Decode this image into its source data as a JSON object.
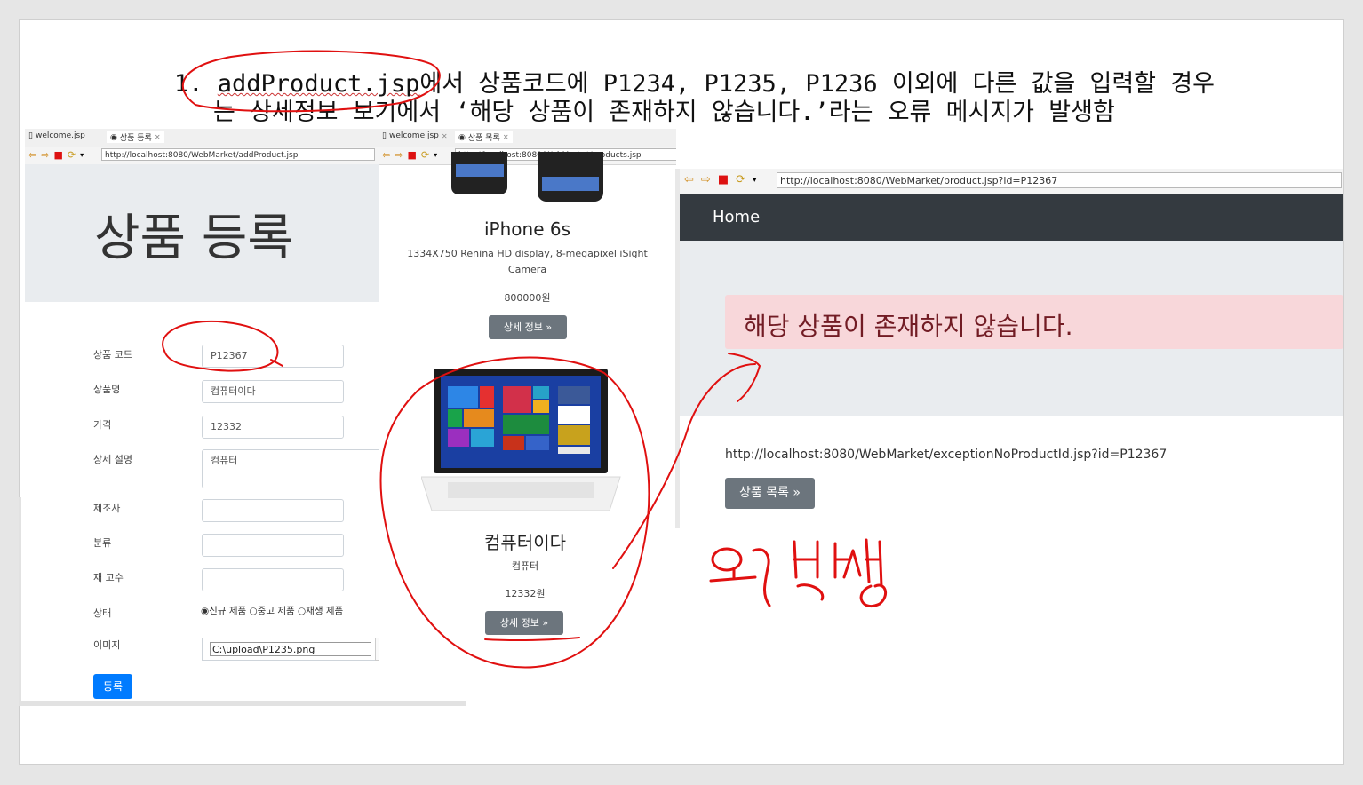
{
  "caption": {
    "line1_prefix": "1. ",
    "line1_file": "addProduct.jsp",
    "line1_rest": "에서 상품코드에 P1234, P1235, P1236 이외에 다른 값을 입력할 경우",
    "line2": "는 상세정보 보기에서 ‘해당 상품이 존재하지 않습니다.’라는 오류 메시지가 발생함"
  },
  "left_browser": {
    "tabs": [
      "welcome.jsp",
      "상품 등록"
    ],
    "url": "http://localhost:8080/WebMarket/addProduct.jsp",
    "heading": "상품 등록",
    "form": {
      "code_label": "상품 코드",
      "code_value": "P12367",
      "name_label": "상품명",
      "name_value": "컴퓨터이다",
      "price_label": "가격",
      "price_value": "12332",
      "desc_label": "상세 설명",
      "desc_value": "컴퓨터",
      "maker_label": "제조사",
      "category_label": "분류",
      "stock_label": "재 고수",
      "condition_label": "상태",
      "condition_options": [
        "신규 제품",
        "중고 제품",
        "재생 제품"
      ],
      "image_label": "이미지",
      "image_value": "C:\\upload\\P1235.png",
      "submit_label": "등록"
    }
  },
  "mid_browser": {
    "tabs": [
      "welcome.jsp",
      "상품 목록"
    ],
    "url": "http://localhost:8080/WebMarket/products.jsp",
    "products": [
      {
        "name": "iPhone 6s",
        "desc": "1334X750 Renina HD display, 8-megapixel iSight Camera",
        "price": "800000원",
        "button": "상세 정보 »"
      },
      {
        "name": "컴퓨터이다",
        "desc": "컴퓨터",
        "price": "12332원",
        "button": "상세 정보 »"
      }
    ]
  },
  "right_browser": {
    "url": "http://localhost:8080/WebMarket/product.jsp?id=P12367",
    "nav_home": "Home",
    "alert_text": "해당 상품이 존재하지 않습니다.",
    "request_url": "http://localhost:8080/WebMarket/exceptionNoProductId.jsp?id=P12367",
    "list_button": "상품 목록 »"
  },
  "annotation": {
    "handwritten": "오류 발생",
    "ink_color": "#e01010"
  },
  "colors": {
    "primary": "#007bff",
    "secondary": "#6c757d",
    "danger_bg": "#f8d7da",
    "danger_text": "#721c24",
    "navbar_dark": "#343a40"
  }
}
